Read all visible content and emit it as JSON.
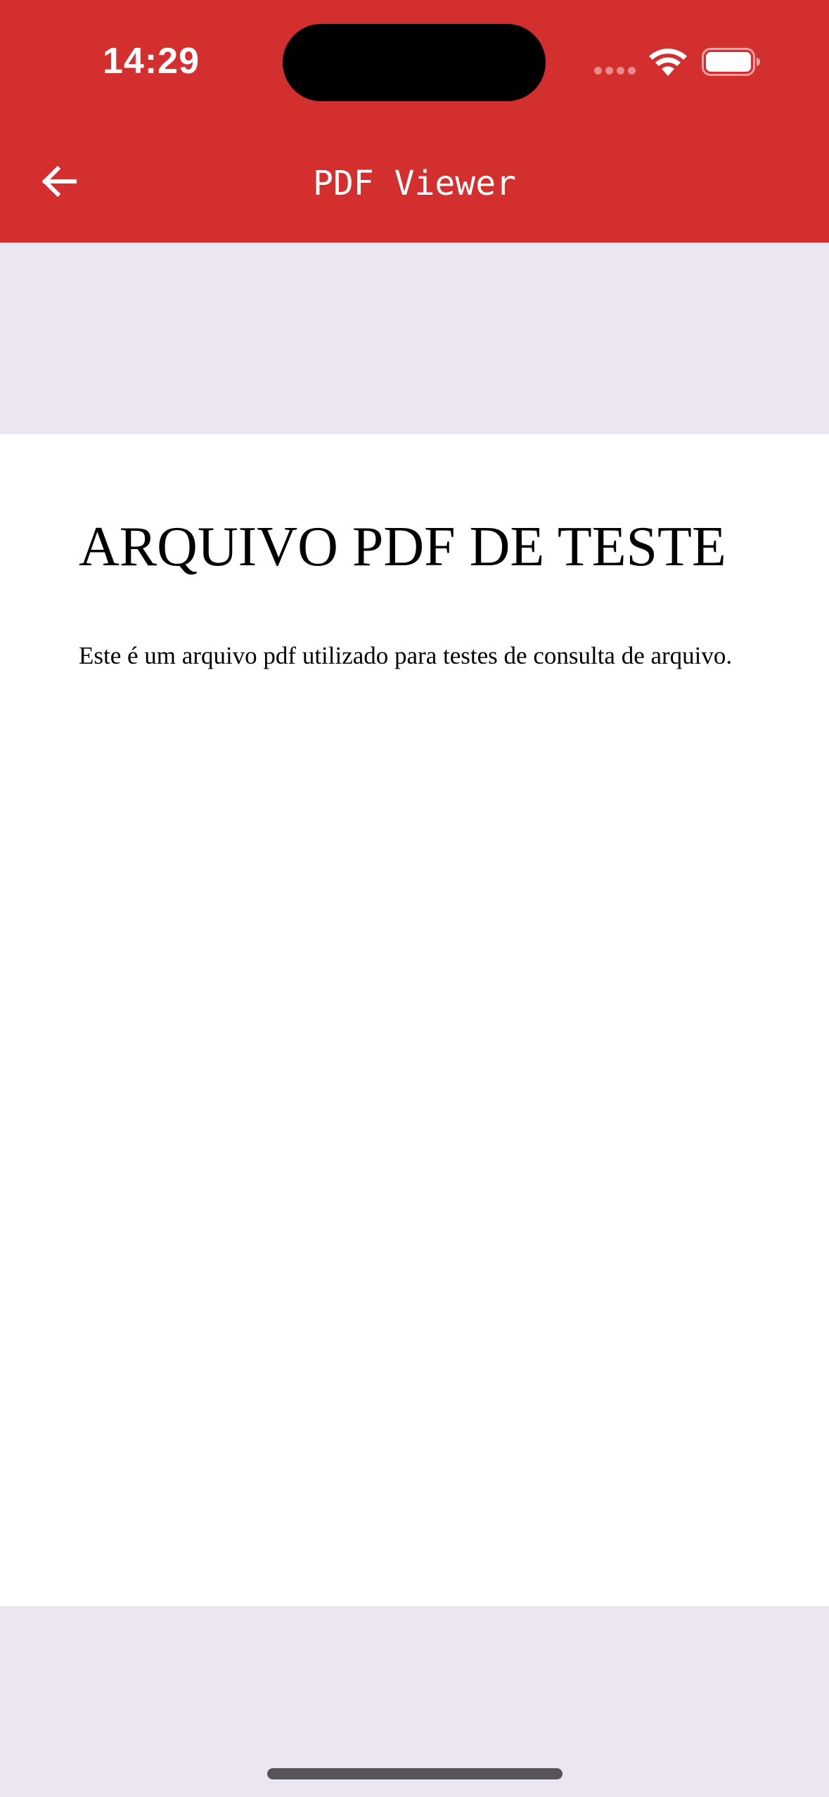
{
  "status_bar": {
    "time": "14:29"
  },
  "app_bar": {
    "title": "PDF Viewer",
    "back_icon": "arrow-back-icon",
    "background": "#D32F2F",
    "foreground": "#FFFFFF"
  },
  "pdf": {
    "title": "ARQUIVO PDF DE TESTE",
    "body": "Este é um arquivo pdf utilizado para testes de consulta de arquivo.",
    "page_background": "#FFFFFF",
    "viewer_background": "#ECE6F2"
  }
}
